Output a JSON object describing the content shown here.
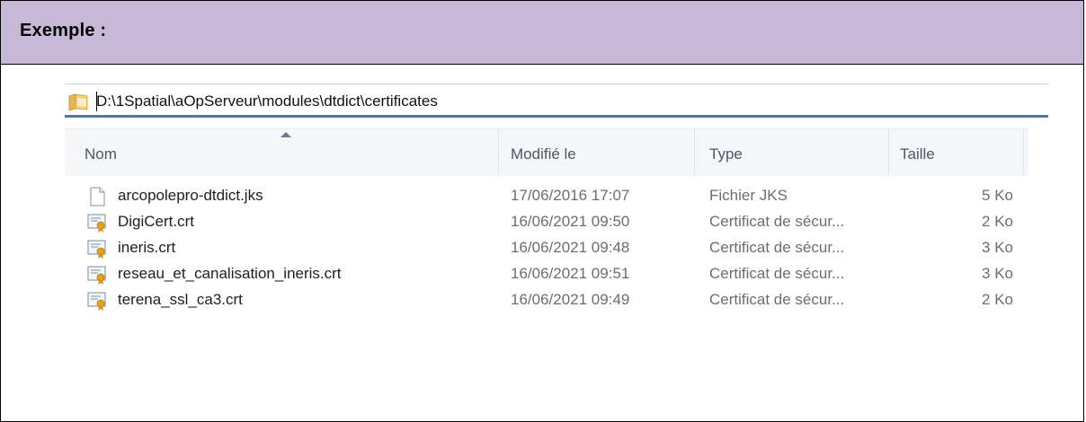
{
  "header": {
    "title": "Exemple :"
  },
  "address_bar": {
    "path": "D:\\1Spatial\\aOpServeur\\modules\\dtdict\\certificates",
    "icon": "folder-icon"
  },
  "columns": {
    "name": "Nom",
    "modified": "Modifié le",
    "type": "Type",
    "size": "Taille",
    "sorted_by": "Nom"
  },
  "files": [
    {
      "name": "arcopolepro-dtdict.jks",
      "modified": "17/06/2016 17:07",
      "type": "Fichier JKS",
      "size": "5 Ko",
      "icon": "blank-file-icon"
    },
    {
      "name": "DigiCert.crt",
      "modified": "16/06/2021 09:50",
      "type": "Certificat de sécur...",
      "size": "2 Ko",
      "icon": "certificate-icon"
    },
    {
      "name": "ineris.crt",
      "modified": "16/06/2021 09:48",
      "type": "Certificat de sécur...",
      "size": "3 Ko",
      "icon": "certificate-icon"
    },
    {
      "name": "reseau_et_canalisation_ineris.crt",
      "modified": "16/06/2021 09:51",
      "type": "Certificat de sécur...",
      "size": "3 Ko",
      "icon": "certificate-icon"
    },
    {
      "name": "terena_ssl_ca3.crt",
      "modified": "16/06/2021 09:49",
      "type": "Certificat de sécur...",
      "size": "2 Ko",
      "icon": "certificate-icon"
    }
  ],
  "colors": {
    "header_bg": "#c8b8d8",
    "address_border": "#4a7ba8",
    "column_header_bg": "#f4f6f8"
  }
}
